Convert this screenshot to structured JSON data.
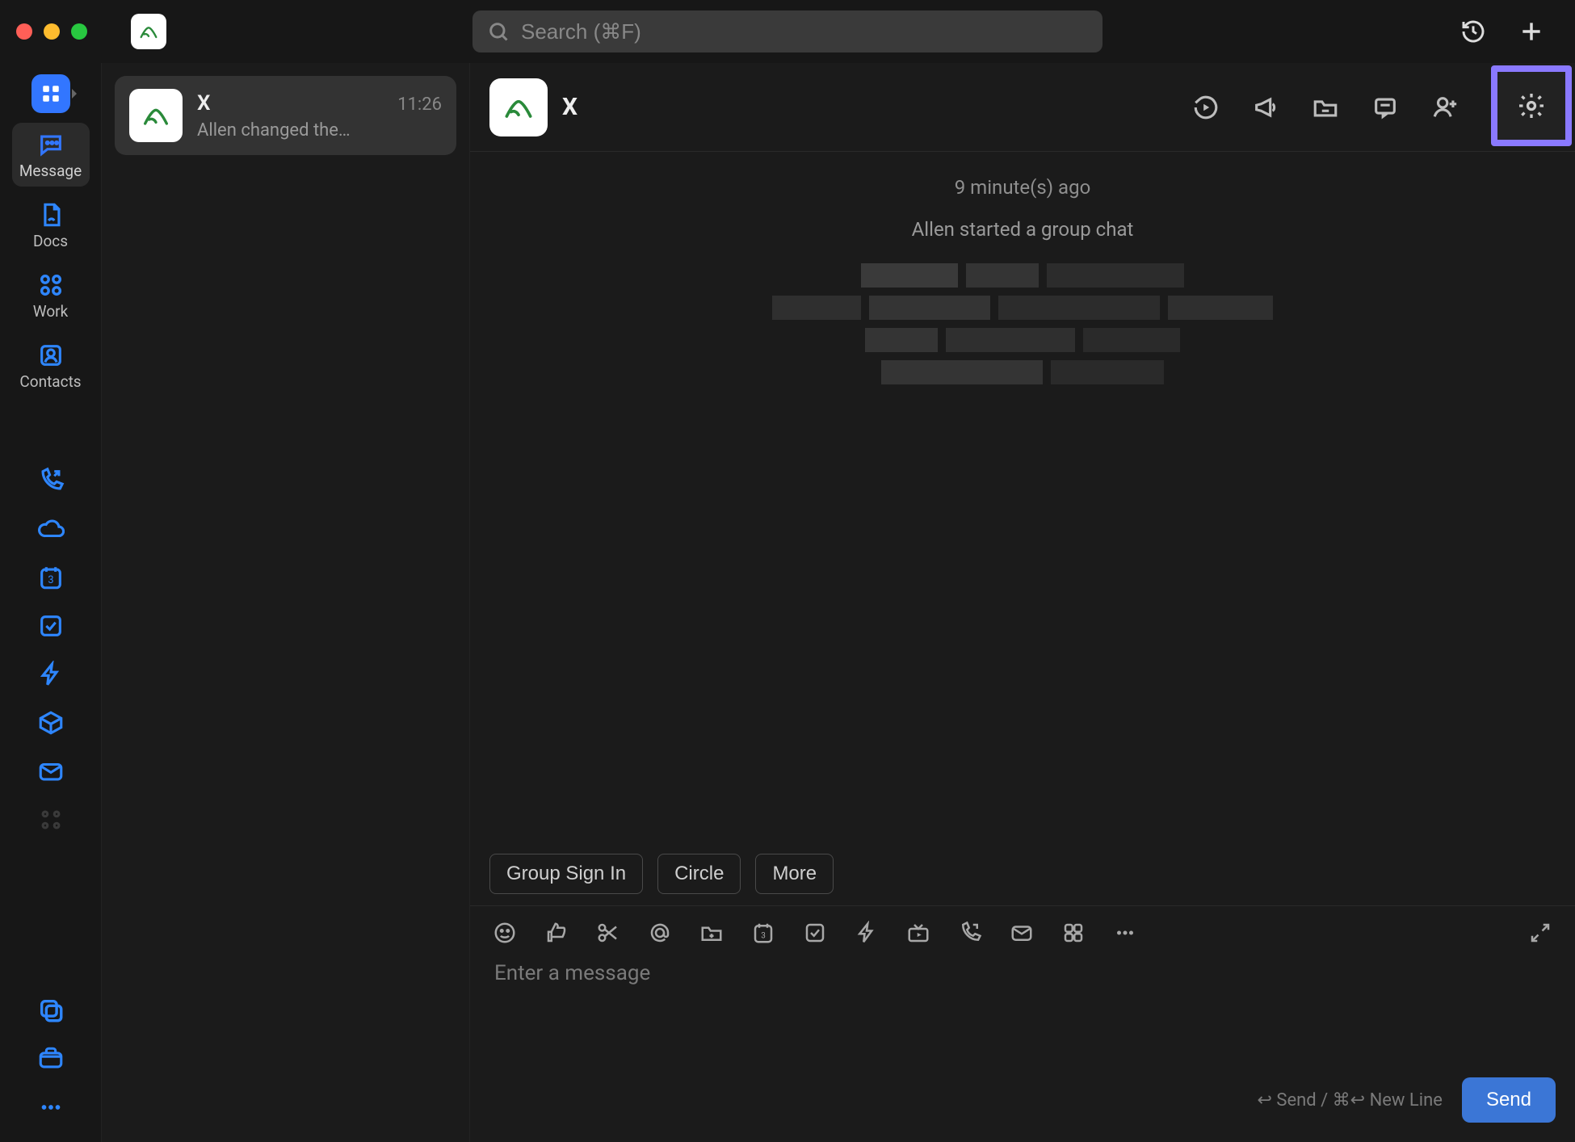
{
  "search": {
    "placeholder": "Search (⌘F)"
  },
  "nav": {
    "items": [
      {
        "label": "Message"
      },
      {
        "label": "Docs"
      },
      {
        "label": "Work"
      },
      {
        "label": "Contacts"
      }
    ]
  },
  "conversations": [
    {
      "name": "X",
      "time": "11:26",
      "preview": "Allen changed the…"
    }
  ],
  "chat": {
    "title": "X",
    "timestamp": "9 minute(s) ago",
    "system_message": "Allen started a group chat",
    "quick_actions": [
      "Group Sign In",
      "Circle",
      "More"
    ],
    "composer_placeholder": "Enter a message",
    "send_hint": "↩ Send / ⌘↩ New Line",
    "send_label": "Send"
  }
}
